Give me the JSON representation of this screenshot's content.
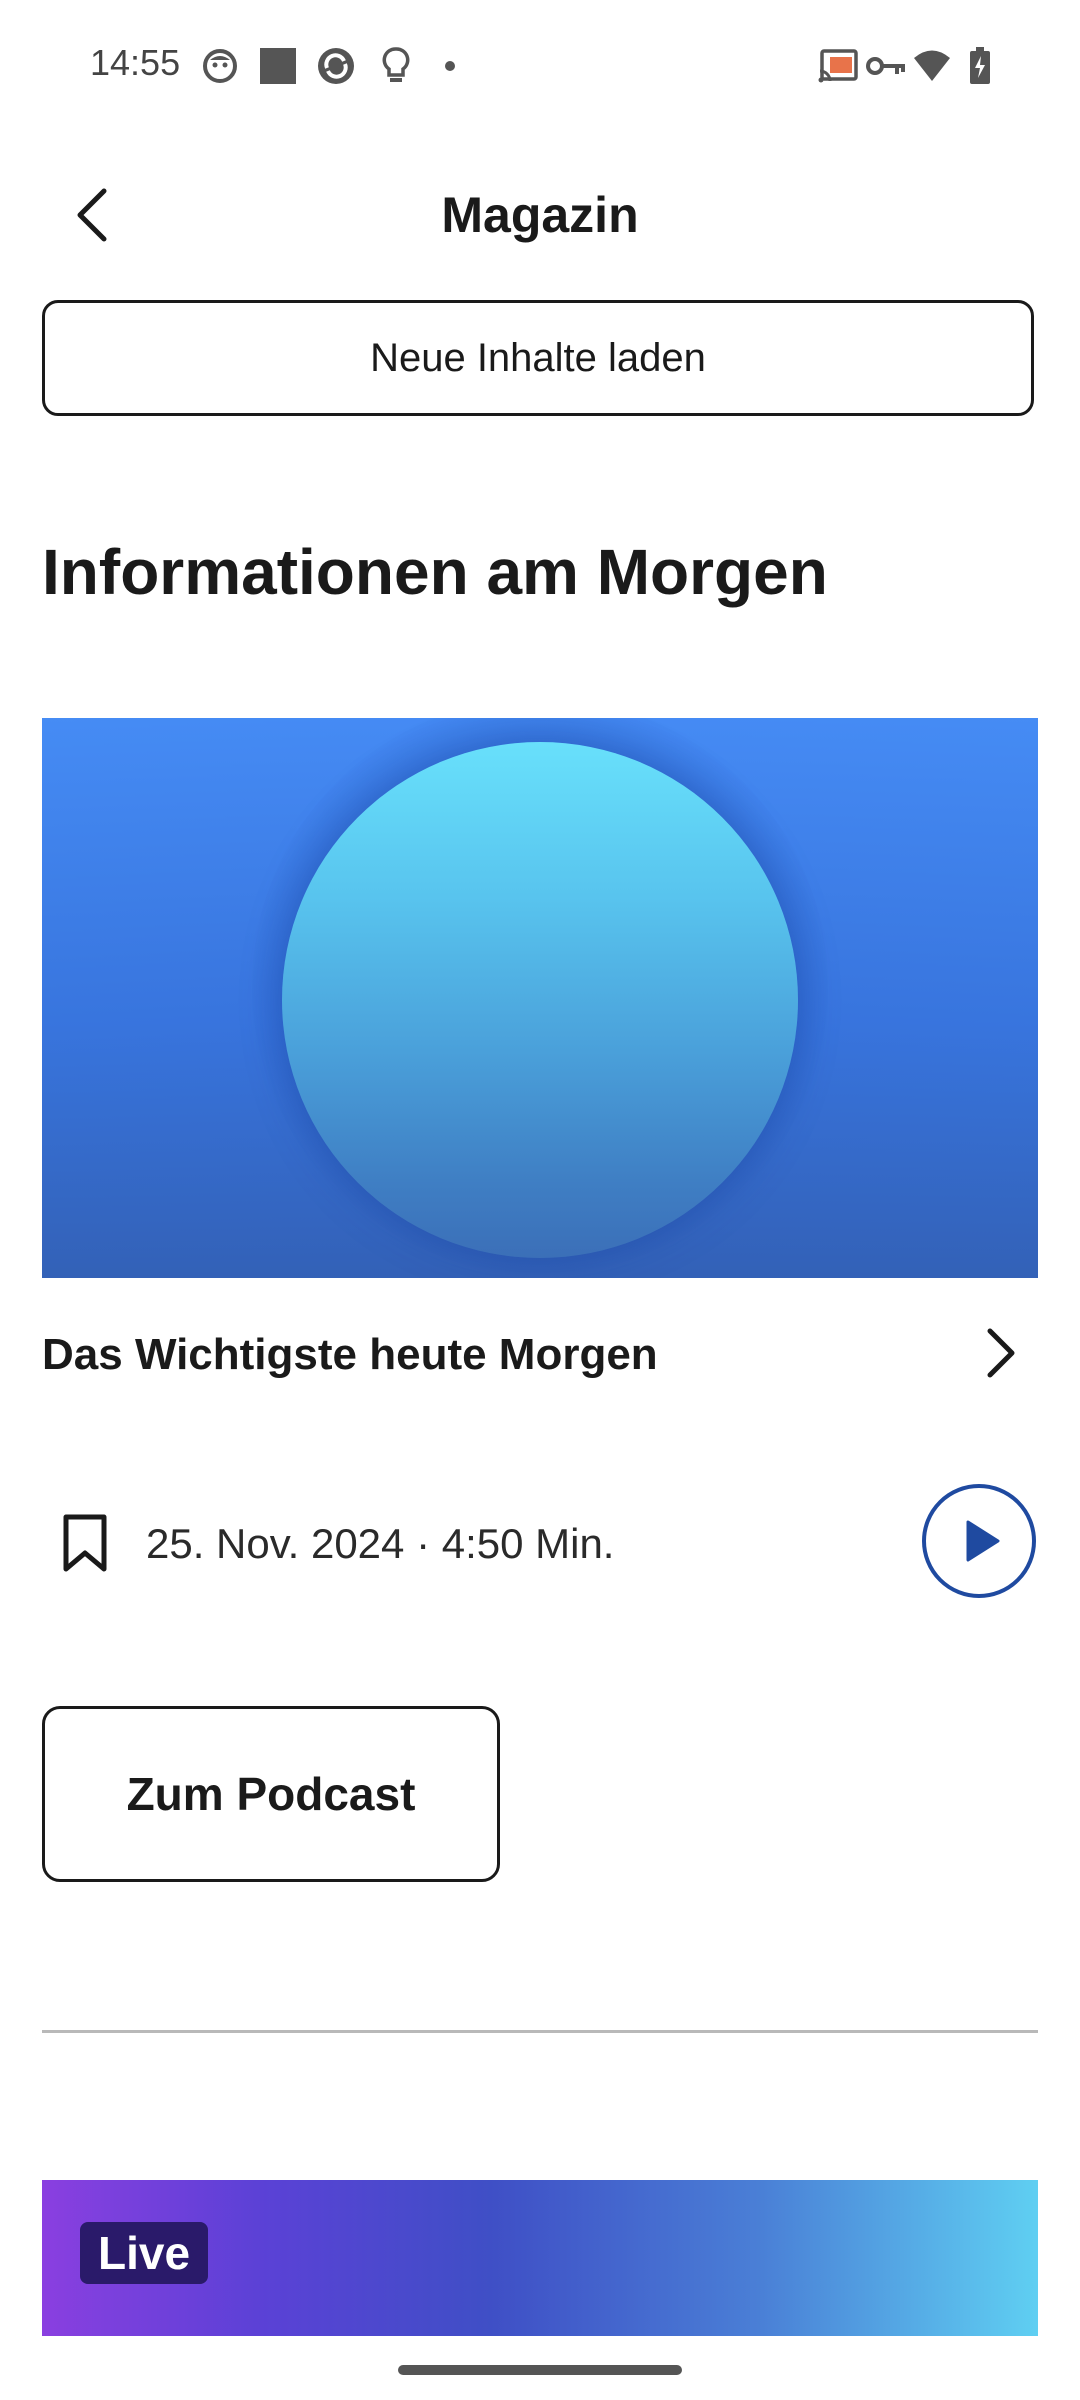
{
  "status_bar": {
    "time": "14:55",
    "left_icons": [
      "face-icon",
      "square-icon",
      "sync-icon",
      "bulb-icon",
      "dot-icon"
    ],
    "right_icons": [
      "cast-icon",
      "key-icon",
      "wifi-icon",
      "battery-charging-icon"
    ]
  },
  "header": {
    "title": "Magazin",
    "back_icon": "chevron-left-icon"
  },
  "reload": {
    "label": "Neue Inhalte laden"
  },
  "section": {
    "heading": "Informationen am Morgen"
  },
  "episode": {
    "title": "Das Wichtigste heute Morgen",
    "meta": "25. Nov. 2024 · 4:50 Min.",
    "bookmark_icon": "bookmark-icon",
    "play_icon": "play-icon",
    "chevron_icon": "chevron-right-icon"
  },
  "podcast": {
    "label": "Zum Podcast"
  },
  "live": {
    "badge": "Live"
  },
  "colors": {
    "accent": "#1f4aa0",
    "hero_blue": "#4189f0",
    "sphere": "#68e0fb",
    "live_purple": "#8a3fe0",
    "live_cyan": "#5fcff2"
  }
}
